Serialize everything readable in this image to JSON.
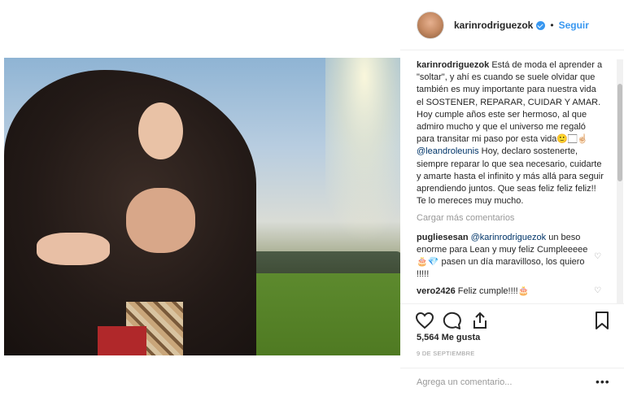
{
  "header": {
    "username": "karinrodriguezok",
    "separator": "•",
    "follow_label": "Seguir"
  },
  "caption": {
    "username": "karinrodriguezok",
    "text_before_mention": "Está de moda el aprender a \"soltar\", y ahí es cuando se suele olvidar que también es muy importante para nuestra vida el SOSTENER, REPARAR, CUIDAR Y AMAR. Hoy cumple años este ser hermoso, al que admiro mucho y que el universo me regaló para transitar mi paso por esta vida",
    "mention": "@leandroleunis",
    "text_after_mention": " Hoy, declaro sostenerte, siempre reparar lo que sea necesario, cuidarte y amarte hasta el infinito y más allá para seguir aprendiendo juntos. Que seas feliz feliz feliz!! Te lo mereces muy mucho."
  },
  "load_more_label": "Cargar más comentarios",
  "comments": [
    {
      "username": "pugliesesan",
      "mention": "@karinrodriguezok",
      "text": " un beso enorme para Lean y muy feliz Cumpleeeee 🎂💎 pasen un día maravilloso, los quiero !!!!!"
    },
    {
      "username": "vero2426",
      "mention": "",
      "text": " Feliz cumple!!!!🎂"
    }
  ],
  "likes_text": "5,564 Me gusta",
  "date_text": "9 DE SEPTIEMBRE",
  "add_comment_placeholder": "Agrega un comentario...",
  "more_options_label": "•••",
  "icons": {
    "like": "heart-icon",
    "comment": "comment-icon",
    "share": "share-icon",
    "save": "bookmark-icon",
    "verified": "verified-badge-icon"
  },
  "colors": {
    "link": "#3897f0",
    "mention": "#003569",
    "muted": "#999999",
    "text": "#262626"
  }
}
